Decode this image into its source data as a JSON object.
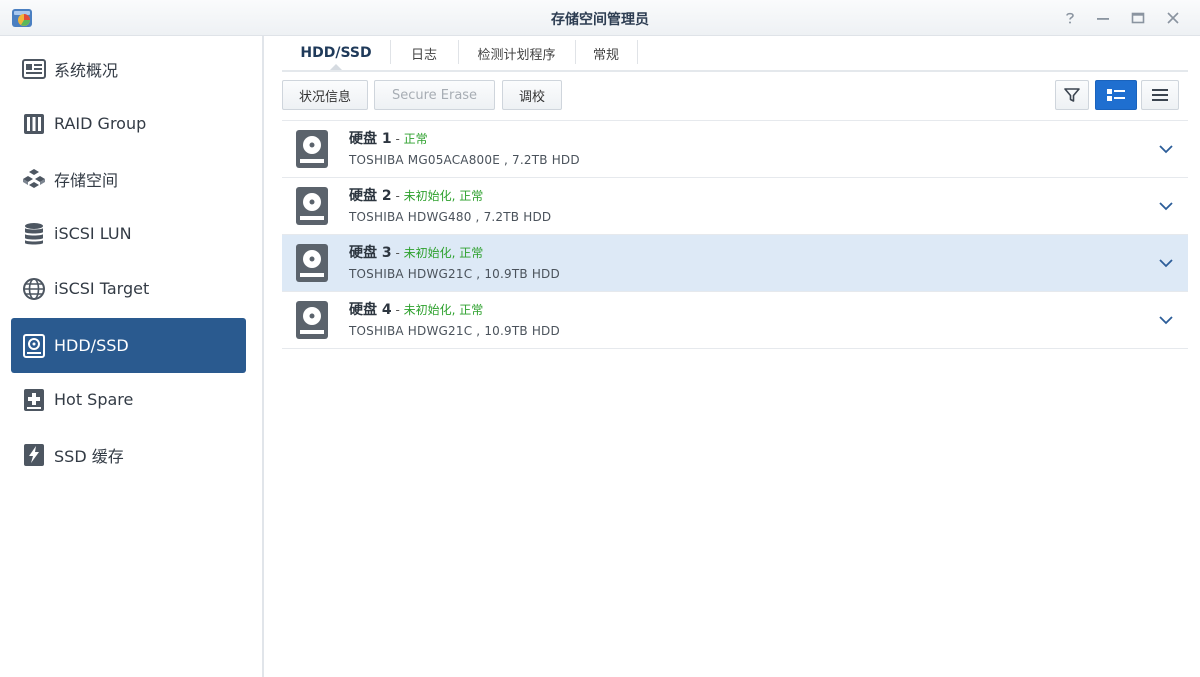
{
  "window": {
    "title": "存储空间管理员",
    "app_icon": "storage-manager-icon",
    "controls": [
      "help-icon",
      "minimize-icon",
      "maximize-icon",
      "close-icon"
    ]
  },
  "sidebar": {
    "items": [
      {
        "label": "系统概况",
        "icon": "overview-icon"
      },
      {
        "label": "RAID Group",
        "icon": "raid-group-icon"
      },
      {
        "label": "存储空间",
        "icon": "storage-pool-icon"
      },
      {
        "label": "iSCSI LUN",
        "icon": "iscsi-lun-icon"
      },
      {
        "label": "iSCSI Target",
        "icon": "globe-icon"
      },
      {
        "label": "HDD/SSD",
        "icon": "hdd-icon",
        "active": true
      },
      {
        "label": "Hot Spare",
        "icon": "hot-spare-icon"
      },
      {
        "label": "SSD 缓存",
        "icon": "ssd-cache-icon"
      }
    ]
  },
  "tabs": [
    {
      "label": "HDD/SSD",
      "active": true
    },
    {
      "label": "日志"
    },
    {
      "label": "检测计划程序"
    },
    {
      "label": "常规"
    }
  ],
  "toolbar": {
    "status_button": "状况信息",
    "secure_erase_button": "Secure Erase",
    "calibrate_button": "调校",
    "filter_icon": "filter-icon",
    "view_detail_icon": "detail-list-icon",
    "view_list_icon": "list-icon"
  },
  "disks": [
    {
      "name": "硬盘 1",
      "dash": " - ",
      "status": "正常",
      "model": "TOSHIBA MG05ACA800E , 7.2TB HDD",
      "selected": false
    },
    {
      "name": "硬盘 2",
      "dash": " - ",
      "status": "未初始化, 正常",
      "model": "TOSHIBA HDWG480 , 7.2TB HDD",
      "selected": false
    },
    {
      "name": "硬盘 3",
      "dash": " - ",
      "status": "未初始化, 正常",
      "model": "TOSHIBA HDWG21C , 10.9TB HDD",
      "selected": true
    },
    {
      "name": "硬盘 4",
      "dash": " - ",
      "status": "未初始化, 正常",
      "model": "TOSHIBA HDWG21C , 10.9TB HDD",
      "selected": false
    }
  ],
  "colors": {
    "accent": "#2a5a8f",
    "status_ok": "#2ea12e",
    "selected_row": "#dde9f6",
    "active_view": "#1f6fd0"
  }
}
